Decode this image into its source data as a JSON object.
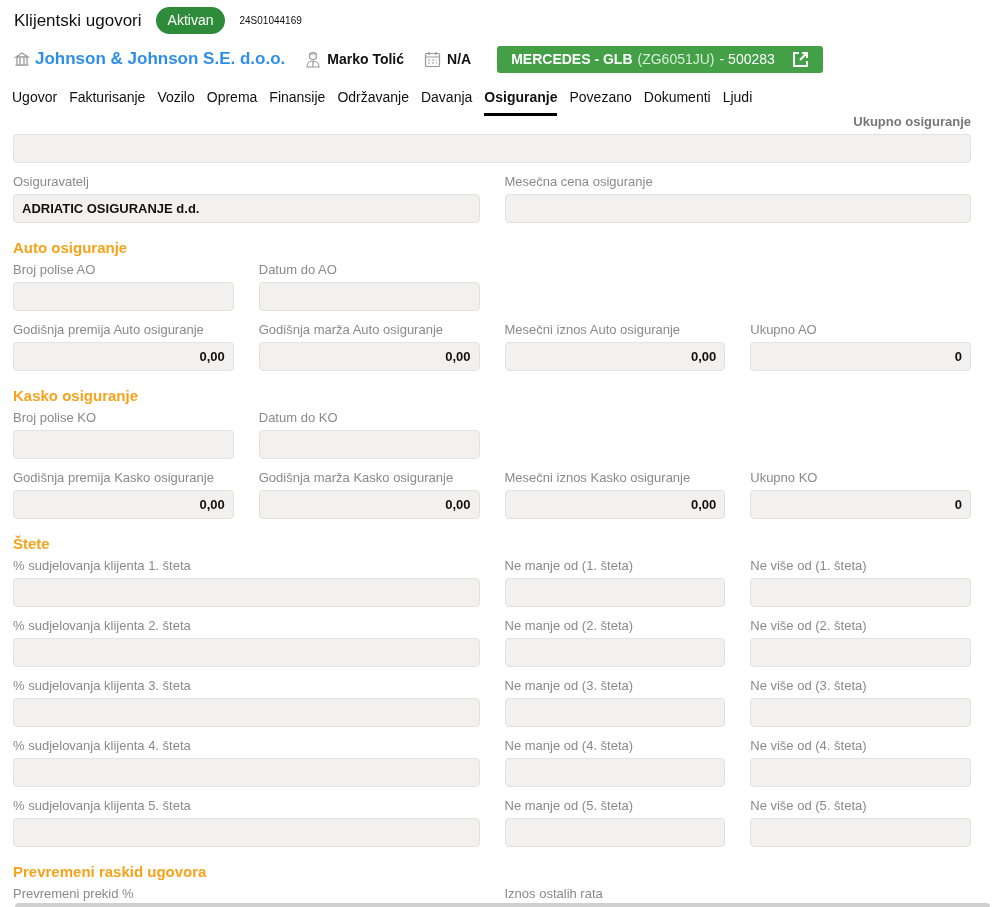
{
  "header": {
    "title": "Klijentski ugovori",
    "status": "Aktivan",
    "number": "24S01044169"
  },
  "info": {
    "company": "Johnson & Johnson S.E. d.o.o.",
    "person": "Marko Tolić",
    "date": "N/A",
    "vehicle": {
      "name": "MERCEDES - GLB",
      "plate": "(ZG6051JU)",
      "code": "- 500283"
    }
  },
  "tabs": [
    {
      "label": "Ugovor",
      "selected": false
    },
    {
      "label": "Fakturisanje",
      "selected": false
    },
    {
      "label": "Vozilo",
      "selected": false
    },
    {
      "label": "Oprema",
      "selected": false
    },
    {
      "label": "Finansije",
      "selected": false
    },
    {
      "label": "Održavanje",
      "selected": false
    },
    {
      "label": "Davanja",
      "selected": false
    },
    {
      "label": "Osiguranje",
      "selected": true
    },
    {
      "label": "Povezano",
      "selected": false
    },
    {
      "label": "Dokumenti",
      "selected": false
    },
    {
      "label": "Ljudi",
      "selected": false
    }
  ],
  "sections": [
    {
      "rows": [
        [
          {
            "label": "Ukupno osiguranje",
            "kind": "total"
          }
        ],
        [
          {
            "label": "Osiguravatelj",
            "value": "ADRIATIC OSIGURANJE d.d.",
            "kind": "wide"
          },
          {
            "label": "Mesečna cena osiguranje",
            "kind": "wide"
          }
        ]
      ]
    },
    {
      "title": "Auto osiguranje",
      "rows": [
        [
          {
            "label": "Broj polise AO",
            "kind": "short"
          },
          {
            "label": "Datum do AO",
            "kind": "short"
          }
        ],
        [
          {
            "label": "Godišnja premija Auto osiguranje",
            "value": "0,00",
            "kind": "amount"
          },
          {
            "label": "Godišnja marža Auto osiguranje",
            "value": "0,00",
            "kind": "amount"
          },
          {
            "label": "Mesečni iznos Auto osiguranje",
            "value": "0,00",
            "kind": "amount"
          },
          {
            "label": "Ukupno AO",
            "value": "0",
            "kind": "amount"
          }
        ]
      ]
    },
    {
      "title": "Kasko osiguranje",
      "rows": [
        [
          {
            "label": "Broj polise KO",
            "kind": "short"
          },
          {
            "label": "Datum do KO",
            "kind": "short"
          }
        ],
        [
          {
            "label": "Godišnja premija Kasko osiguranje",
            "value": "0,00",
            "kind": "amount"
          },
          {
            "label": "Godišnja marža Kasko osiguranje",
            "value": "0,00",
            "kind": "amount"
          },
          {
            "label": "Mesečni iznos Kasko osiguranje",
            "value": "0,00",
            "kind": "amount"
          },
          {
            "label": "Ukupno KO",
            "value": "0",
            "kind": "amount"
          }
        ]
      ]
    },
    {
      "title": "Štete",
      "rows": [
        [
          {
            "label": "% sudjelovanja klijenta 1. šteta",
            "kind": "wide"
          },
          {
            "label": "Ne manje od (1. šteta)",
            "kind": "short"
          },
          {
            "label": "Ne više od (1. šteta)",
            "kind": "short"
          }
        ],
        [
          {
            "label": "% sudjelovanja klijenta 2. šteta",
            "kind": "wide"
          },
          {
            "label": "Ne manje od (2. šteta)",
            "kind": "short"
          },
          {
            "label": "Ne više od (2. šteta)",
            "kind": "short"
          }
        ],
        [
          {
            "label": "% sudjelovanja klijenta 3. šteta",
            "kind": "wide"
          },
          {
            "label": "Ne manje od (3. šteta)",
            "kind": "short"
          },
          {
            "label": "Ne više od (3. šteta)",
            "kind": "short"
          }
        ],
        [
          {
            "label": "% sudjelovanja klijenta 4. šteta",
            "kind": "wide"
          },
          {
            "label": "Ne manje od (4. šteta)",
            "kind": "short"
          },
          {
            "label": "Ne više od (4. šteta)",
            "kind": "short"
          }
        ],
        [
          {
            "label": "% sudjelovanja klijenta 5. šteta",
            "kind": "wide"
          },
          {
            "label": "Ne manje od (5. šteta)",
            "kind": "short"
          },
          {
            "label": "Ne više od (5. šteta)",
            "kind": "short"
          }
        ]
      ]
    },
    {
      "title": "Prevremeni raskid ugovora",
      "rows": [
        [
          {
            "label": "Prevremeni prekid %",
            "kind": "wide"
          },
          {
            "label": "Iznos ostalih rata",
            "kind": "wide"
          }
        ]
      ]
    }
  ]
}
